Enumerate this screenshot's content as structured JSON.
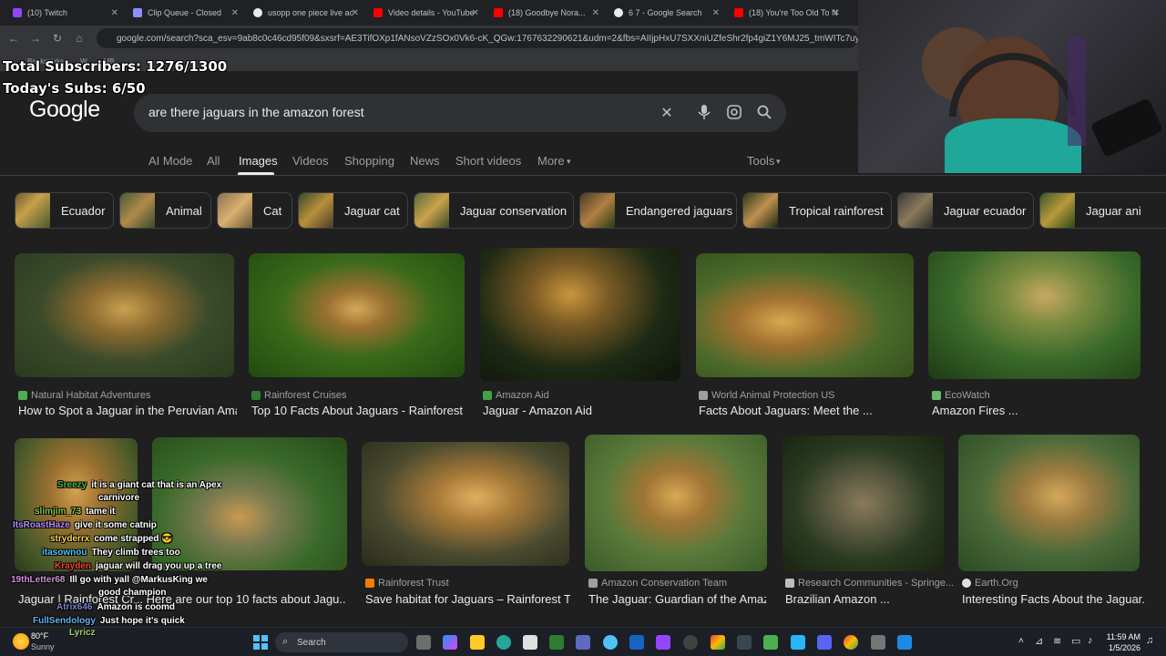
{
  "browser": {
    "tabs": [
      {
        "label": "(10) Twitch",
        "color": "#9146ff"
      },
      {
        "label": "Clip Queue - Closed",
        "color": "#8e8eff"
      },
      {
        "label": "usopp one piece live ac",
        "color": "#e8eaed"
      },
      {
        "label": "Video details - YouTube",
        "color": "#ff0000"
      },
      {
        "label": "(18) Goodbye Nora...",
        "color": "#ff0000"
      },
      {
        "label": "6 7 - Google Search",
        "color": "#e8eaed"
      },
      {
        "label": "(18) You're Too Old To N",
        "color": "#ff0000"
      }
    ],
    "url": "google.com/search?sca_esv=9ab8c0c46cd95f09&sxsrf=AE3TifOXp1fANsoVZzSOx0Vk6-cK_QGw:1767632290621&udm=2&fbs=AIIjpHxU7SXXniUZfeShr2fp4giZ1Y6MJ25_tmWITc7uy4KIeiAkWG4OlB",
    "bookmarks": [
      "Bookmarks",
      "W",
      "MB"
    ]
  },
  "overlay": {
    "total_subs": "Total Subscribers: 1276/1300",
    "today_subs": "Today's Subs: 6/50"
  },
  "google": {
    "logo": "Google",
    "query": "are there jaguars in the amazon forest",
    "nav": [
      "AI Mode",
      "All",
      "Images",
      "Videos",
      "Shopping",
      "News",
      "Short videos",
      "More"
    ],
    "tools": "Tools",
    "chips": [
      "Ecuador",
      "Animal",
      "Cat",
      "Jaguar cat",
      "Jaguar conservation",
      "Endangered jaguars",
      "Tropical rainforest",
      "Jaguar ecuador",
      "Jaguar ani"
    ]
  },
  "results_row1": [
    {
      "source": "Natural Habitat Adventures",
      "title": "How to Spot a Jaguar in the Peruvian Ama...",
      "fav": "#4caf50"
    },
    {
      "source": "Rainforest Cruises",
      "title": "Top 10 Facts About Jaguars - Rainforest ...",
      "fav": "#2e7d32"
    },
    {
      "source": "Amazon Aid",
      "title": "Jaguar - Amazon Aid",
      "fav": "#43a047"
    },
    {
      "source": "World Animal Protection US",
      "title": "Facts About Jaguars: Meet the ...",
      "fav": "#9e9e9e"
    },
    {
      "source": "EcoWatch",
      "title": "Amazon Fires ...",
      "fav": "#66bb6a"
    }
  ],
  "results_row2": [
    {
      "source": "",
      "title": "Jaguar | Rainforest Cr...",
      "fav": "#2e7d32"
    },
    {
      "source": "",
      "title": "Here are our top 10 facts about Jagu...",
      "fav": "#2e7d32"
    },
    {
      "source": "Rainforest Trust",
      "title": "Save habitat for Jaguars – Rainforest Tr...",
      "fav": "#f57c00"
    },
    {
      "source": "Amazon Conservation Team",
      "title": "The Jaguar: Guardian of the Amaz...",
      "fav": "#9e9e9e"
    },
    {
      "source": "Research Communities - Springe...",
      "title": "Brazilian Amazon ...",
      "fav": "#bdbdbd"
    },
    {
      "source": "Earth.Org",
      "title": "Interesting Facts About the Jaguar...",
      "fav": "#e0e0e0"
    }
  ],
  "chat": [
    {
      "user": "Sreezy",
      "msg": "it is a giant cat that is an Apex",
      "color": "#4caf50"
    },
    {
      "user": "",
      "msg": "carnivore",
      "color": "#4caf50"
    },
    {
      "user": "slimjim_73",
      "msg": "tame it",
      "color": "#8bc34a"
    },
    {
      "user": "ItsRoastHaze",
      "msg": "give it some catnip",
      "color": "#b388ff"
    },
    {
      "user": "stryderrx",
      "msg": "come strapped 😎",
      "color": "#ffd54f"
    },
    {
      "user": "itasownou",
      "msg": "They climb trees too",
      "color": "#4fc3f7"
    },
    {
      "user": "Krayden",
      "msg": "jaguar will drag you up a tree",
      "color": "#f44336"
    },
    {
      "user": "19thLetter68",
      "msg": "Ill go with yall @MarkusKing we",
      "color": "#ce93d8"
    },
    {
      "user": "",
      "msg": "good champion",
      "color": "#ce93d8"
    },
    {
      "user": "Atrix646",
      "msg": "Amazon is coomd",
      "color": "#7986cb"
    },
    {
      "user": "FullSendology",
      "msg": "Just hope it's quick",
      "color": "#64b5f6"
    },
    {
      "user": "Lyricz",
      "msg": "",
      "color": "#9ccc65"
    }
  ],
  "taskbar": {
    "weather_temp": "80°F",
    "weather_desc": "Sunny",
    "search": "Search",
    "time": "11:59 AM",
    "date": "1/5/2026"
  }
}
